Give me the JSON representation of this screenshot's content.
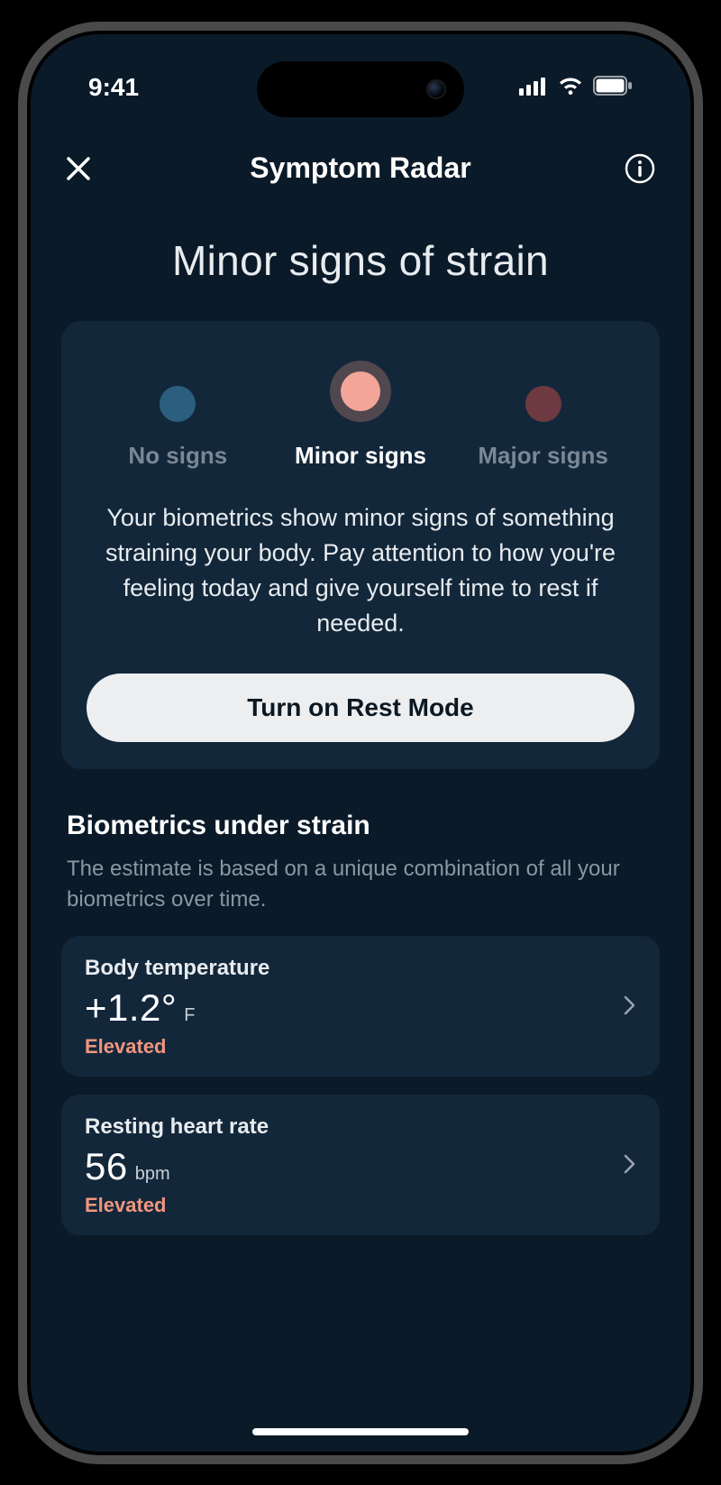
{
  "status": {
    "time": "9:41"
  },
  "header": {
    "title": "Symptom Radar"
  },
  "page": {
    "heading": "Minor signs of strain"
  },
  "card": {
    "levels": [
      {
        "label": "No signs",
        "active": false,
        "color": "#2b5f7d"
      },
      {
        "label": "Minor signs",
        "active": true,
        "color": "#f2a598"
      },
      {
        "label": "Major signs",
        "active": false,
        "color": "#6e3a42"
      }
    ],
    "description": "Your biometrics show minor signs of something straining your body. Pay attention to how you're feeling today and give yourself time to rest if needed.",
    "button_label": "Turn on Rest Mode"
  },
  "biometrics": {
    "title": "Biometrics under strain",
    "subtitle": "The estimate is based on a unique combination of all your biometrics over time.",
    "items": [
      {
        "name": "Body temperature",
        "value": "+1.2°",
        "unit": "F",
        "status": "Elevated"
      },
      {
        "name": "Resting heart rate",
        "value": "56",
        "unit": "bpm",
        "status": "Elevated"
      }
    ]
  },
  "colors": {
    "accent_status": "#f0967f",
    "card_bg": "#13273a",
    "bg": "#0b1a28"
  }
}
